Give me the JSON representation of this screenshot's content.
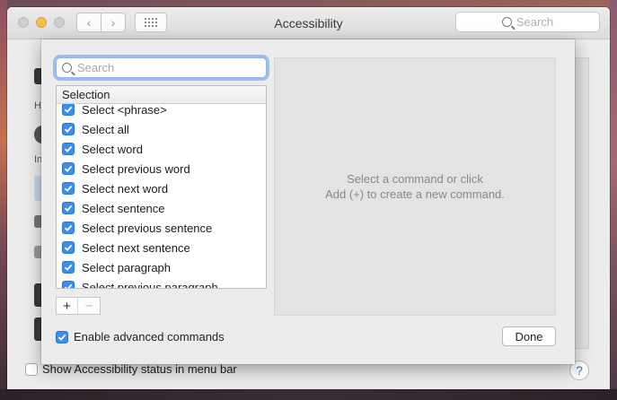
{
  "window": {
    "title": "Accessibility",
    "search_placeholder": "Search",
    "show_status_label": "Show Accessibility status in menu bar",
    "help_label": "?"
  },
  "background": {
    "letter_h": "H",
    "letter_in": "In"
  },
  "sheet": {
    "search_placeholder": "Search",
    "list_header": "Selection",
    "items": [
      "Select <phrase>",
      "Select all",
      "Select word",
      "Select previous word",
      "Select next word",
      "Select sentence",
      "Select previous sentence",
      "Select next sentence",
      "Select paragraph",
      "Select previous paragraph"
    ],
    "add_label": "+",
    "remove_label": "−",
    "detail_line1": "Select a command or click",
    "detail_line2": "Add (+) to create a new command.",
    "advanced_label": "Enable advanced commands",
    "done_label": "Done"
  },
  "colors": {
    "checkbox_blue": "#3b8ef0",
    "focus_ring": "#6098eb"
  },
  "icons": {
    "back": "chevron-left-icon",
    "forward": "chevron-right-icon",
    "grid": "grid-icon",
    "search": "search-icon",
    "check": "checkmark-icon"
  }
}
